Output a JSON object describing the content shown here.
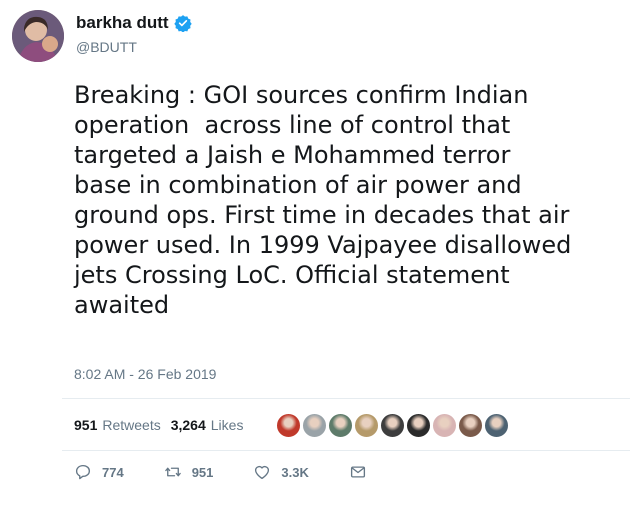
{
  "author": {
    "display_name": "barkha dutt",
    "handle": "@BDUTT",
    "verified": true
  },
  "tweet": {
    "text": "Breaking : GOI sources confirm Indian\noperation  across line of control that\ntargeted a Jaish e Mohammed terror\nbase in combination of air power and\nground ops. First time in decades that air\npower used. In 1999 Vajpayee disallowed\njets Crossing LoC. Official statement\nawaited",
    "timestamp": "8:02 AM - 26 Feb 2019"
  },
  "stats": {
    "retweets_count": "951",
    "retweets_label": "Retweets",
    "likes_count": "3,264",
    "likes_label": "Likes"
  },
  "liker_avatars": [
    "#c0392b",
    "#9aa3a8",
    "#5e7b6a",
    "#b59a6a",
    "#3d3d3d",
    "#2b2b2b",
    "#d8b4b4",
    "#7a5a4a",
    "#4d6272"
  ],
  "actions": {
    "reply_count": "774",
    "retweet_count": "951",
    "like_count": "3.3K"
  },
  "colors": {
    "verified_badge": "#1da1f2",
    "secondary_text": "#657786",
    "primary_text": "#14171a"
  }
}
